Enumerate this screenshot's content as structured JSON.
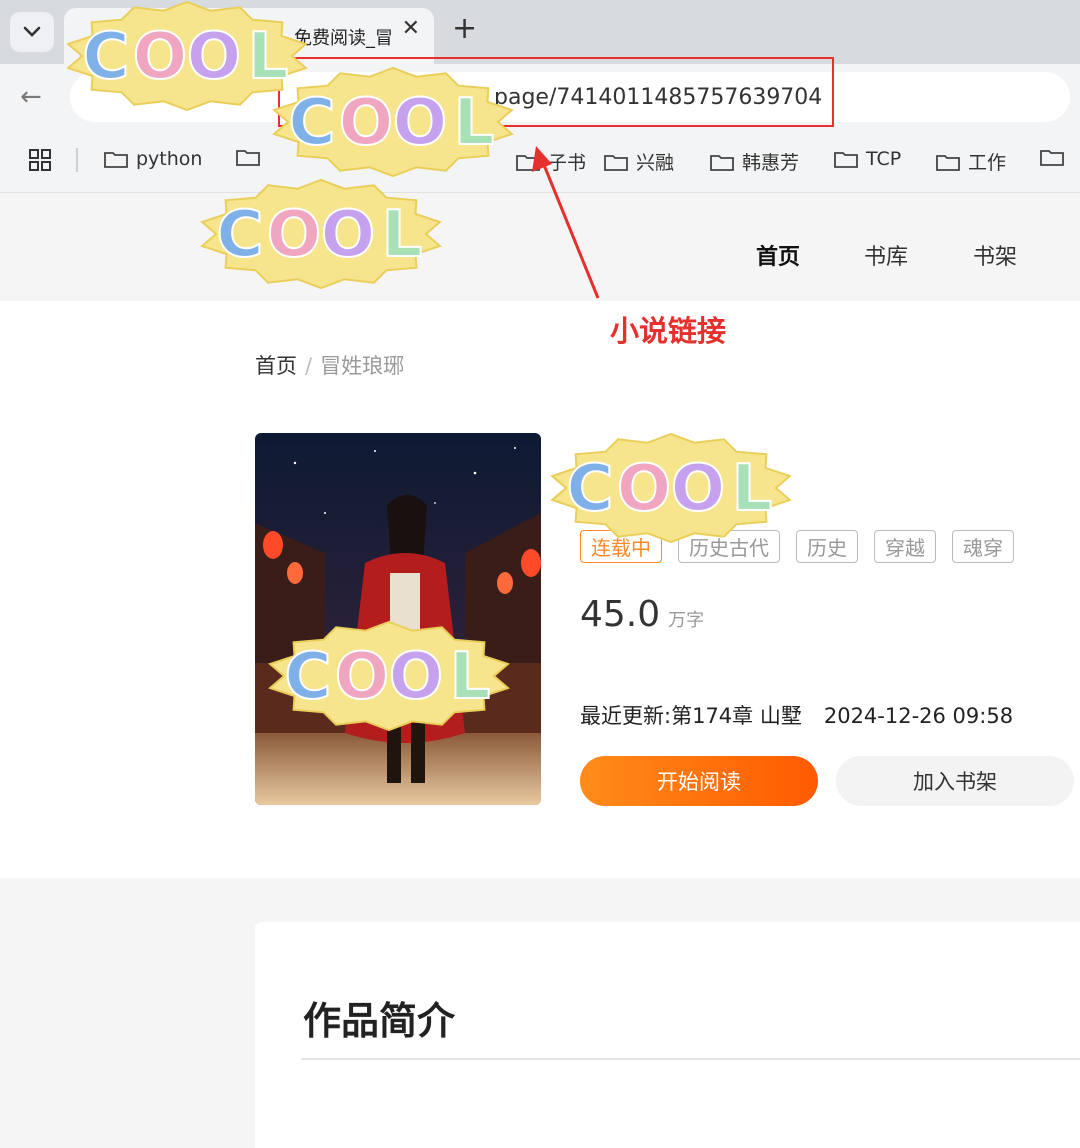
{
  "browser": {
    "tab_title": "免费阅读_冒",
    "url_visible": "page/7414011485757639704",
    "bookmarks": [
      "python",
      "",
      "子书",
      "兴融",
      "韩惠芳",
      "TCP",
      "工作"
    ]
  },
  "site": {
    "nav": [
      "首页",
      "书库",
      "书架"
    ],
    "breadcrumb": {
      "home": "首页",
      "sep": "/",
      "current": "冒姓琅琊"
    }
  },
  "annotation": {
    "label": "小说链接",
    "color": "#e5302d"
  },
  "book": {
    "tags": [
      "连载中",
      "历史古代",
      "历史",
      "穿越",
      "魂穿"
    ],
    "word_count": "45.0",
    "word_unit": "万字",
    "latest_label": "最近更新:",
    "latest_chapter": "第174章 山墅",
    "latest_date": "2024-12-26 09:58",
    "btn_read": "开始阅读",
    "btn_shelf": "加入书架"
  },
  "intro": {
    "title": "作品简介"
  },
  "sticker_text": "COOL",
  "colors": {
    "accent": "#ff6a00",
    "sticker_base": "#f6e58d"
  }
}
